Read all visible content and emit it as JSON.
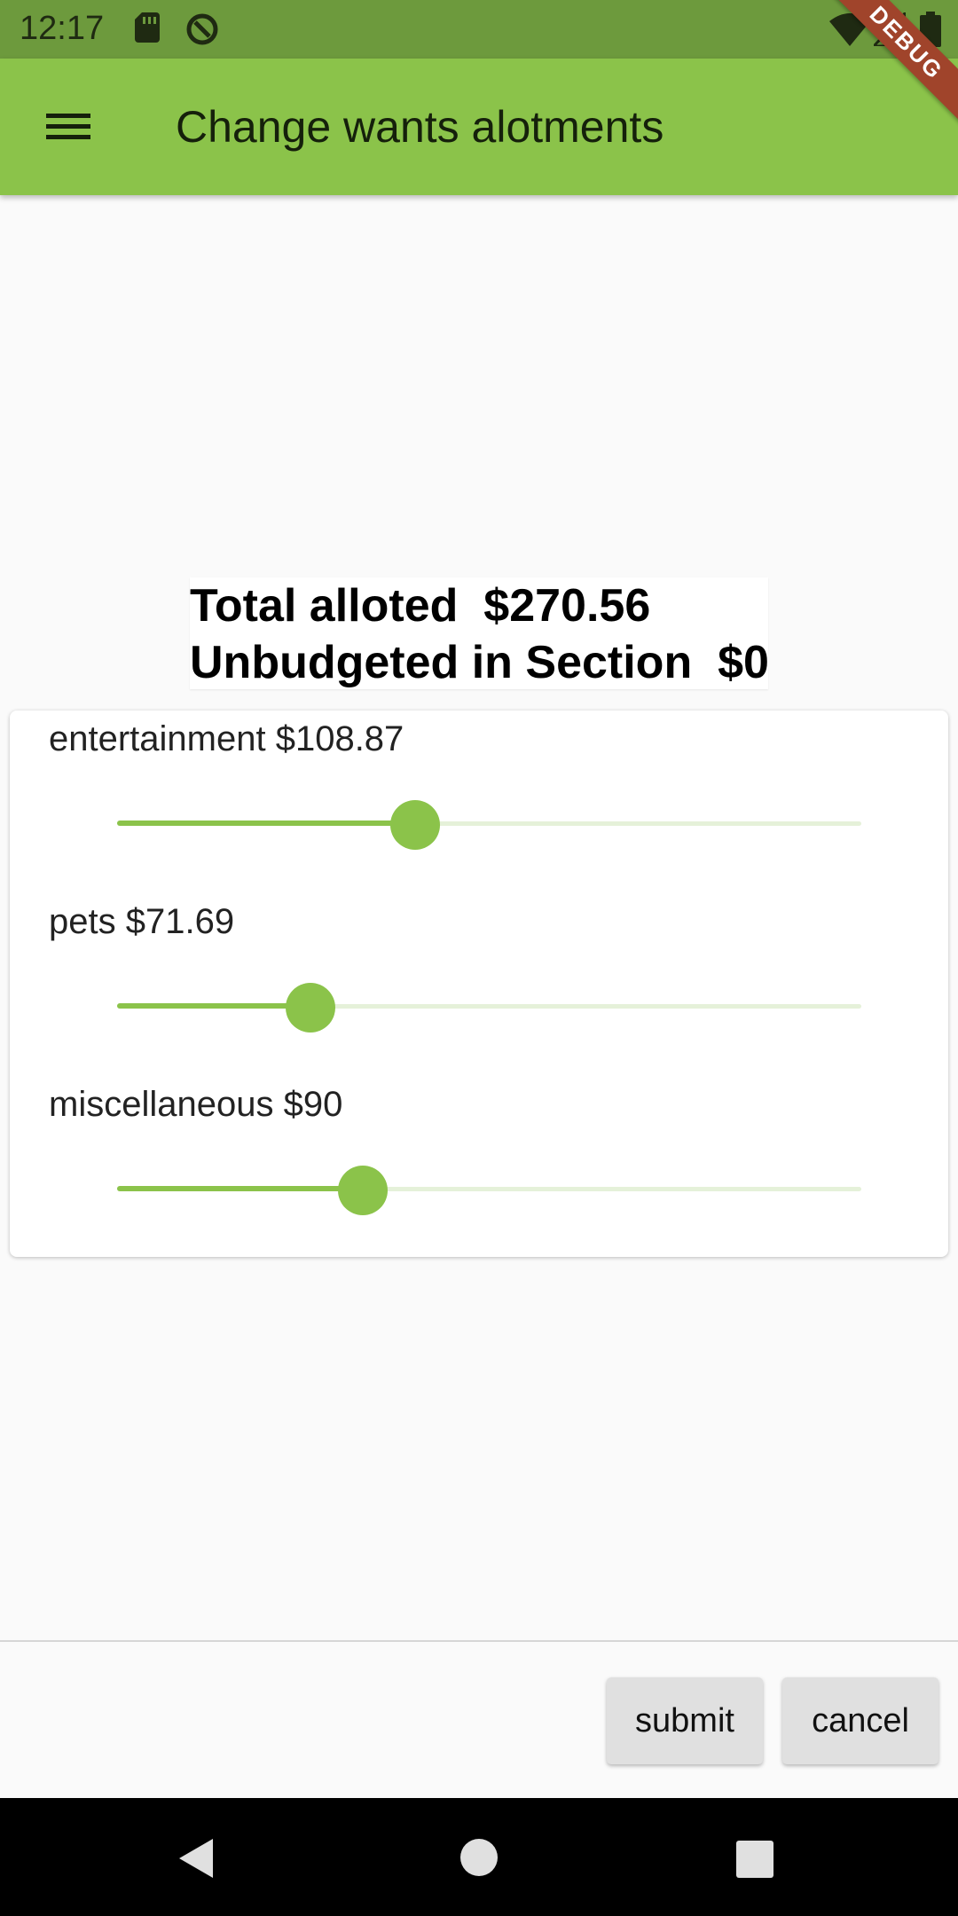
{
  "status_bar": {
    "time": "12:17",
    "icons": [
      "sd-card-icon",
      "sync-icon",
      "wifi-icon",
      "signal-icon",
      "battery-icon"
    ]
  },
  "app_bar": {
    "title": "Change wants alotments",
    "menu_icon": "menu-icon",
    "background": "#8bc34a",
    "debug_banner": "DEBUG"
  },
  "summary": {
    "total_line": "Total alloted  $270.56",
    "unbudgeted_line": "Unbudgeted in Section  $0"
  },
  "sliders": [
    {
      "label": "entertainment $108.87",
      "fraction": 0.4
    },
    {
      "label": "pets $71.69",
      "fraction": 0.26
    },
    {
      "label": "miscellaneous $90",
      "fraction": 0.33
    }
  ],
  "actions": {
    "submit_label": "submit",
    "cancel_label": "cancel"
  },
  "nav_bar": {
    "icons": [
      "back-icon",
      "home-icon",
      "recents-icon"
    ]
  },
  "colors": {
    "accent": "#8bc34a",
    "status_bar": "#6d9a3d",
    "slider_track": "#e5f1d9",
    "debug_ribbon": "#a0442b"
  }
}
